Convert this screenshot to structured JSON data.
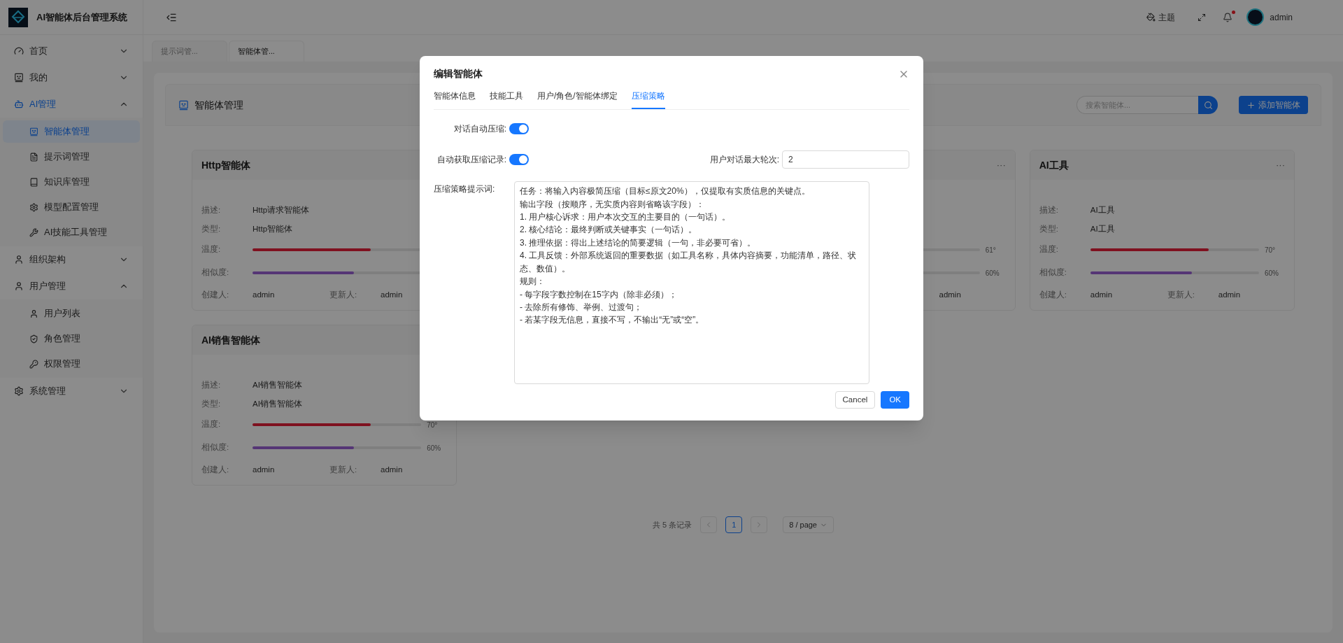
{
  "app": {
    "title": "AI智能体后台管理系统"
  },
  "sidebar": {
    "items": [
      {
        "label": "首页",
        "expanded": false,
        "selected": false
      },
      {
        "label": "我的",
        "expanded": false,
        "selected": false
      },
      {
        "label": "AI管理",
        "expanded": true,
        "selected": true,
        "children": [
          {
            "label": "智能体管理",
            "selected": true
          },
          {
            "label": "提示词管理",
            "selected": false
          },
          {
            "label": "知识库管理",
            "selected": false
          },
          {
            "label": "模型配置管理",
            "selected": false
          },
          {
            "label": "AI技能工具管理",
            "selected": false
          }
        ]
      },
      {
        "label": "组织架构",
        "expanded": false,
        "selected": false
      },
      {
        "label": "用户管理",
        "expanded": true,
        "selected": false,
        "children": [
          {
            "label": "用户列表",
            "selected": false
          },
          {
            "label": "角色管理",
            "selected": false
          },
          {
            "label": "权限管理",
            "selected": false
          }
        ]
      },
      {
        "label": "系统管理",
        "expanded": false,
        "selected": false
      }
    ]
  },
  "header": {
    "theme_label": "主题",
    "has_notification": true,
    "user": "admin"
  },
  "page_tabs": [
    {
      "label": "提示词管...",
      "selected": false
    },
    {
      "label": "智能体管...",
      "selected": true
    }
  ],
  "panel": {
    "title": "智能体管理",
    "search": {
      "placeholder": "搜索智能体..."
    },
    "add_button": "添加智能体"
  },
  "cards_left": [
    {
      "title": "Http智能体",
      "desc_label": "描述:",
      "desc": "Http请求智能体",
      "type_label": "类型:",
      "type": "Http智能体",
      "temperature": {
        "label": "温度:",
        "level": 0.7
      },
      "similarity": {
        "label": "相似度:",
        "level": 0.6
      },
      "creator_label": "创建人:",
      "creator": "admin",
      "updater_label": "更新人:",
      "updater": "admin"
    },
    {
      "title": "AI销售智能体",
      "desc_label": "描述:",
      "desc": "AI销售智能体",
      "type_label": "类型:",
      "type": "AI销售智能体",
      "temperature": {
        "label": "温度:",
        "level": 0.7,
        "reading": "70°"
      },
      "similarity": {
        "label": "相似度:",
        "level": 0.6,
        "reading": "60%"
      },
      "creator_label": "创建人:",
      "creator": "admin",
      "updater_label": "更新人:",
      "updater": "admin"
    }
  ],
  "cards_right": [
    {
      "more": "···",
      "temperature": {
        "reading": "61°"
      },
      "similarity": {
        "reading": "60%"
      },
      "updater": "admin"
    },
    {
      "title": "AI工具",
      "more": "···",
      "desc_label": "描述:",
      "desc": "AI工具",
      "type_label": "类型:",
      "type": "AI工具",
      "temperature": {
        "label": "温度:",
        "level": 0.7,
        "reading": "70°"
      },
      "similarity": {
        "label": "相似度:",
        "level": 0.6,
        "reading": "60%"
      },
      "creator_label": "创建人:",
      "creator": "admin",
      "updater_label": "更新人:",
      "updater": "admin"
    }
  ],
  "pagination": {
    "total": "共 5 条记录",
    "pages": [
      {
        "label": "1",
        "selected": true
      }
    ],
    "page_size": "8 / page"
  },
  "modal": {
    "title": "编辑智能体",
    "tabs": [
      {
        "label": "智能体信息",
        "selected": false
      },
      {
        "label": "技能工具",
        "selected": false
      },
      {
        "label": "用户/角色/智能体绑定",
        "selected": false
      },
      {
        "label": "压缩策略",
        "selected": true
      }
    ],
    "auto_compress": {
      "label": "对话自动压缩:",
      "on": true
    },
    "auto_fetch": {
      "label": "自动获取压缩记录:",
      "on": true
    },
    "max_rounds": {
      "label": "用户对话最大轮次:",
      "value": "2"
    },
    "prompt": {
      "label": "压缩策略提示词:",
      "lines": [
        "任务：将输入内容极简压缩（目标≤原文20%），仅提取有实质信息的关键点。",
        "输出字段（按顺序，无实质内容则省略该字段）：",
        "1. 用户核心诉求：用户本次交互的主要目的（一句话）。",
        "2. 核心结论：最终判断或关键事实（一句话）。",
        "3. 推理依据：得出上述结论的简要逻辑（一句，非必要可省）。",
        "4. 工具反馈：外部系统返回的重要数据（如工具名称，具体内容摘要，功能清单，路径、状态、数值）。",
        "规则：",
        "- 每字段字数控制在15字内（除非必须）；",
        "- 去除所有修饰、举例、过渡句；",
        "- 若某字段无信息，直接不写，不输出“无”或“空”。"
      ]
    },
    "buttons": {
      "cancel": "Cancel",
      "ok": "OK"
    }
  }
}
